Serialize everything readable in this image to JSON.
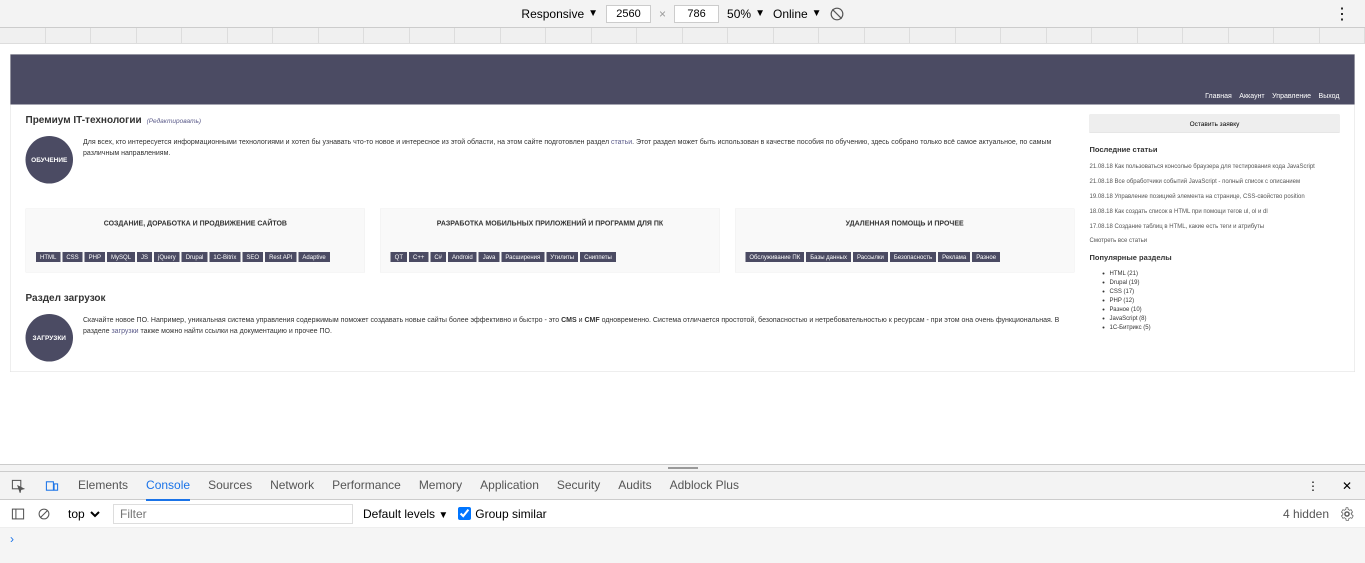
{
  "devtools_top": {
    "responsive": "Responsive",
    "width": "2560",
    "height": "786",
    "zoom": "50%",
    "network": "Online"
  },
  "header_nav": [
    "Главная",
    "Аккаунт",
    "Управление",
    "Выход"
  ],
  "main": {
    "title": "Премиум IT-технологии",
    "edit": "(Редактировать)",
    "badge1": "ОБУЧЕНИЕ",
    "intro_before": "Для всех, кто интересуется информационными технологиями и хотел бы узнавать что-то новое и интересное из этой области, на этом сайте подготовлен раздел ",
    "intro_link": "статьи",
    "intro_after": ". Этот раздел может быть использован в качестве пособия по обучению, здесь собрано только всё самое актуальное, по самым различным направлениям."
  },
  "cols": [
    {
      "title": "СОЗДАНИЕ, ДОРАБОТКА И ПРОДВИЖЕНИЕ САЙТОВ",
      "tags": [
        "HTML",
        "CSS",
        "PHP",
        "MySQL",
        "JS",
        "jQuery",
        "Drupal",
        "1C-Bitrix",
        "SEO",
        "Rest API",
        "Adaptive"
      ]
    },
    {
      "title": "РАЗРАБОТКА МОБИЛЬНЫХ ПРИЛОЖЕНИЙ И ПРОГРАММ ДЛЯ ПК",
      "tags": [
        "QT",
        "C++",
        "C#",
        "Android",
        "Java",
        "Расширения",
        "Утилиты",
        "Сниппеты"
      ]
    },
    {
      "title": "УДАЛЕННАЯ ПОМОЩЬ И ПРОЧЕЕ",
      "tags": [
        "Обслуживание ПК",
        "Базы данных",
        "Рассылки",
        "Безопасность",
        "Реклама",
        "Разное"
      ]
    }
  ],
  "downloads": {
    "title": "Раздел загрузок",
    "badge": "ЗАГРУЗКИ",
    "text_before": "Скачайте новое ПО. Например, уникальная система управления содержимым поможет создавать новые сайты более эффективно и быстро - это ",
    "bold1": "CMS",
    "and": " и ",
    "bold2": "CMF",
    "text_mid": " одновременно. Система отличается простотой, безопасностью и нетребовательностью к ресурсам - при этом она очень функциональная. В разделе ",
    "link": "загрузки",
    "text_after": " также можно найти ссылки на документацию и прочее ПО."
  },
  "sidebar": {
    "btn": "Оставить заявку",
    "articles_title": "Последние статьи",
    "articles": [
      "21.08.18 Как пользоваться консолью браузера для тестирования кода JavaScript",
      "21.08.18 Все обработчики событий JavaScript - полный список с описанием",
      "19.08.18 Управление позицией элемента на странице, CSS-свойство position",
      "18.08.18 Как создать список в HTML при помощи тегов ul, ol и dl",
      "17.08.18 Создание таблиц в HTML, какие есть теги и атрибуты"
    ],
    "all_articles": "Смотреть все статьи",
    "popular_title": "Популярные разделы",
    "popular": [
      "HTML (21)",
      "Drupal (19)",
      "CSS (17)",
      "PHP (12)",
      "Разное (10)",
      "JavaScript (8)",
      "1С-Битрикс (5)"
    ]
  },
  "dt_tabs": [
    "Elements",
    "Console",
    "Sources",
    "Network",
    "Performance",
    "Memory",
    "Application",
    "Security",
    "Audits",
    "Adblock Plus"
  ],
  "console": {
    "context": "top",
    "filter_placeholder": "Filter",
    "levels": "Default levels",
    "group": "Group similar",
    "hidden": "4 hidden"
  }
}
